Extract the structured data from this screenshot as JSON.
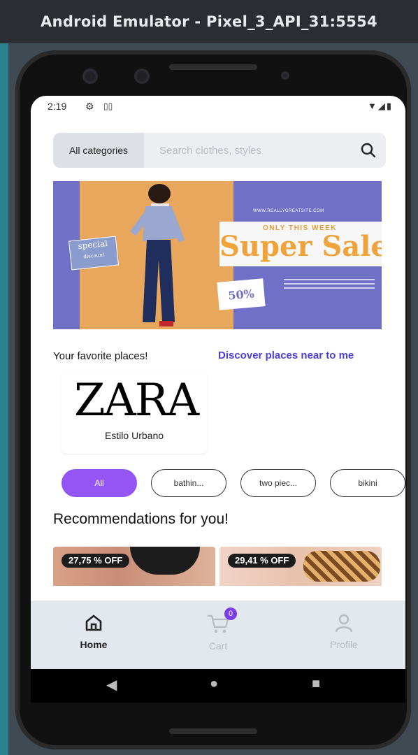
{
  "window": {
    "title": "Android Emulator - Pixel_3_API_31:5554"
  },
  "status_bar": {
    "time": "2:19",
    "settings_icon": "gear-icon",
    "sim_icon": "sim-icon",
    "right_icons": "wifi-signal-battery-icons"
  },
  "search": {
    "category_label": "All categories",
    "placeholder": "Search clothes, styles",
    "value": ""
  },
  "banner": {
    "url_text": "WWW.REALLYGREATSITE.COM",
    "headline_small": "ONLY THIS WEEK",
    "headline": "Super Sale",
    "tag_special": "special",
    "tag_special_sub": "discount",
    "tag_discount": "50%"
  },
  "favorites": {
    "label": "Your favorite places!",
    "discover_link": "Discover places near to me",
    "places": [
      {
        "logo": "ZARA",
        "subtitle": "Estilo Urbano"
      }
    ]
  },
  "chips": [
    {
      "label": "All",
      "active": true
    },
    {
      "label": "bathin...",
      "active": false
    },
    {
      "label": "two piec...",
      "active": false
    },
    {
      "label": "bikini",
      "active": false
    }
  ],
  "recommendations": {
    "title": "Recommendations for you!",
    "items": [
      {
        "discount": "27,75 % OFF"
      },
      {
        "discount": "29,41 % OFF"
      }
    ]
  },
  "bottom_nav": {
    "home_label": "Home",
    "cart_label": "Cart",
    "cart_count": "0",
    "profile_label": "Profile"
  },
  "colors": {
    "accent": "#9356f4",
    "link": "#4b3fd6",
    "banner": "#7070c6",
    "banner_orange": "#e8a75c"
  }
}
